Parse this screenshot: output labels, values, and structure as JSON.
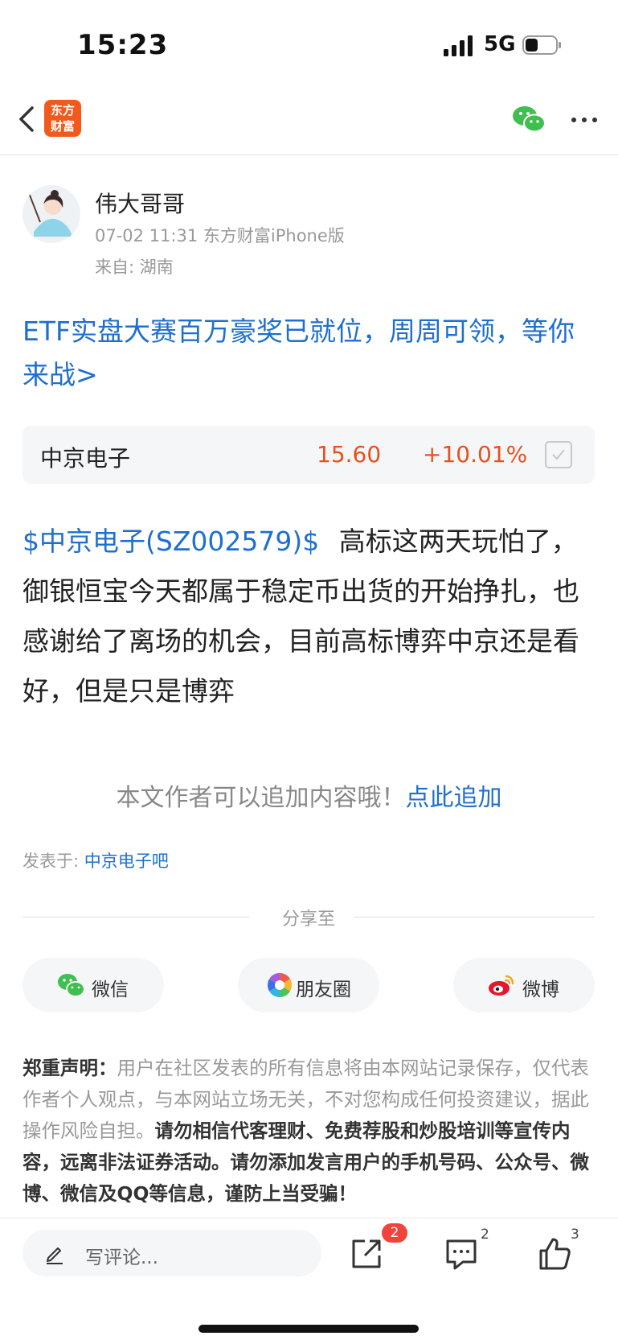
{
  "status_bar": {
    "time": "15:23",
    "network": "5G"
  },
  "nav": {
    "logo_line1": "东方",
    "logo_line2": "财富"
  },
  "author": {
    "name": "伟大哥哥",
    "meta": "07-02 11:31 东方财富iPhone版",
    "location": "来自: 湖南"
  },
  "promo_text": "ETF实盘大赛百万豪奖已就位，周周可领，等你来战>",
  "stock": {
    "name": "中京电子",
    "price": "15.60",
    "change": "+10.01%"
  },
  "post": {
    "tag": "$中京电子(SZ002579)$",
    "text": "高标这两天玩怕了，御银恒宝今天都属于稳定币出货的开始挣扎，也感谢给了离场的机会，目前高标博弈中京还是看好，但是只是博弈"
  },
  "append": {
    "prefix": "本文作者可以追加内容哦！",
    "link": "点此追加"
  },
  "posted_in": {
    "label": "发表于:",
    "link": "中京电子吧"
  },
  "share": {
    "label": "分享至",
    "buttons": [
      {
        "label": "微信",
        "icon": "wechat-icon"
      },
      {
        "label": "朋友圈",
        "icon": "moments-icon"
      },
      {
        "label": "微博",
        "icon": "weibo-icon"
      }
    ]
  },
  "disclaimer": {
    "heading": "郑重声明：",
    "normal": "用户在社区发表的所有信息将由本网站记录保存，仅代表作者个人观点，与本网站立场无关，不对您构成任何投资建议，据此操作风险自担。",
    "bold": "请勿相信代客理财、免费荐股和炒股培训等宣传内容，远离非法证券活动。请勿添加发言用户的手机号码、公众号、微博、微信及QQ等信息，谨防上当受骗！"
  },
  "bottom_bar": {
    "comment_placeholder": "写评论...",
    "share_badge": "2",
    "comment_count": "2",
    "like_count": "3"
  },
  "colors": {
    "link_blue": "#1f6fcf",
    "price_red": "#e6521f",
    "brand_orange": "#f25a1d",
    "badge_red": "#f0443c"
  }
}
